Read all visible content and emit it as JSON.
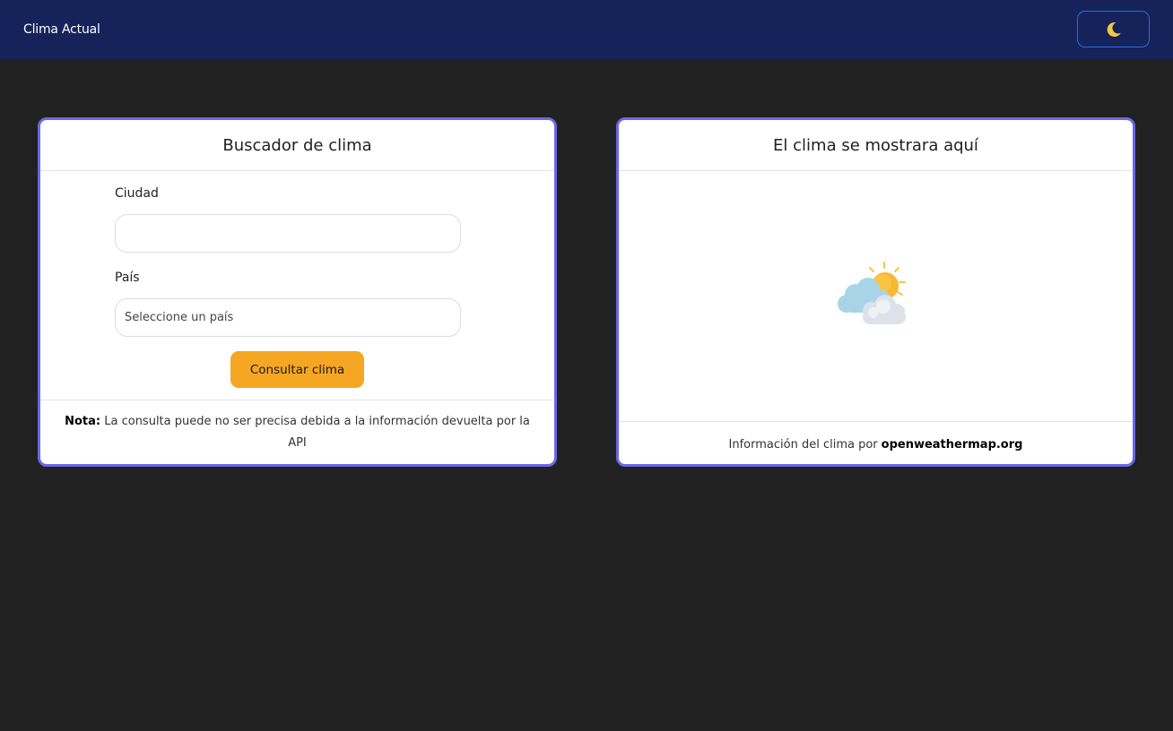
{
  "app": {
    "title": "Clima Actual"
  },
  "theme_toggle": {
    "icon": "moon-icon",
    "icon_color": "#f5c842",
    "border_color": "#1f6fe8"
  },
  "search_card": {
    "title": "Buscador de clima",
    "city_label": "Ciudad",
    "city_value": "",
    "country_label": "País",
    "country_selected": "Seleccione un país",
    "submit_label": "Consultar clima",
    "note_label": "Nota:",
    "note_text": "La consulta puede no ser precisa debida a la información devuelta por la API"
  },
  "result_card": {
    "title": "El clima se mostrara aquí",
    "icon": "partly-cloudy-icon",
    "footer_text": "Información del clima por",
    "footer_link": "openweathermap.org"
  },
  "colors": {
    "navbar": "#16225a",
    "background": "#212121",
    "card_border": "#6a68e6",
    "button": "#f5a623"
  }
}
